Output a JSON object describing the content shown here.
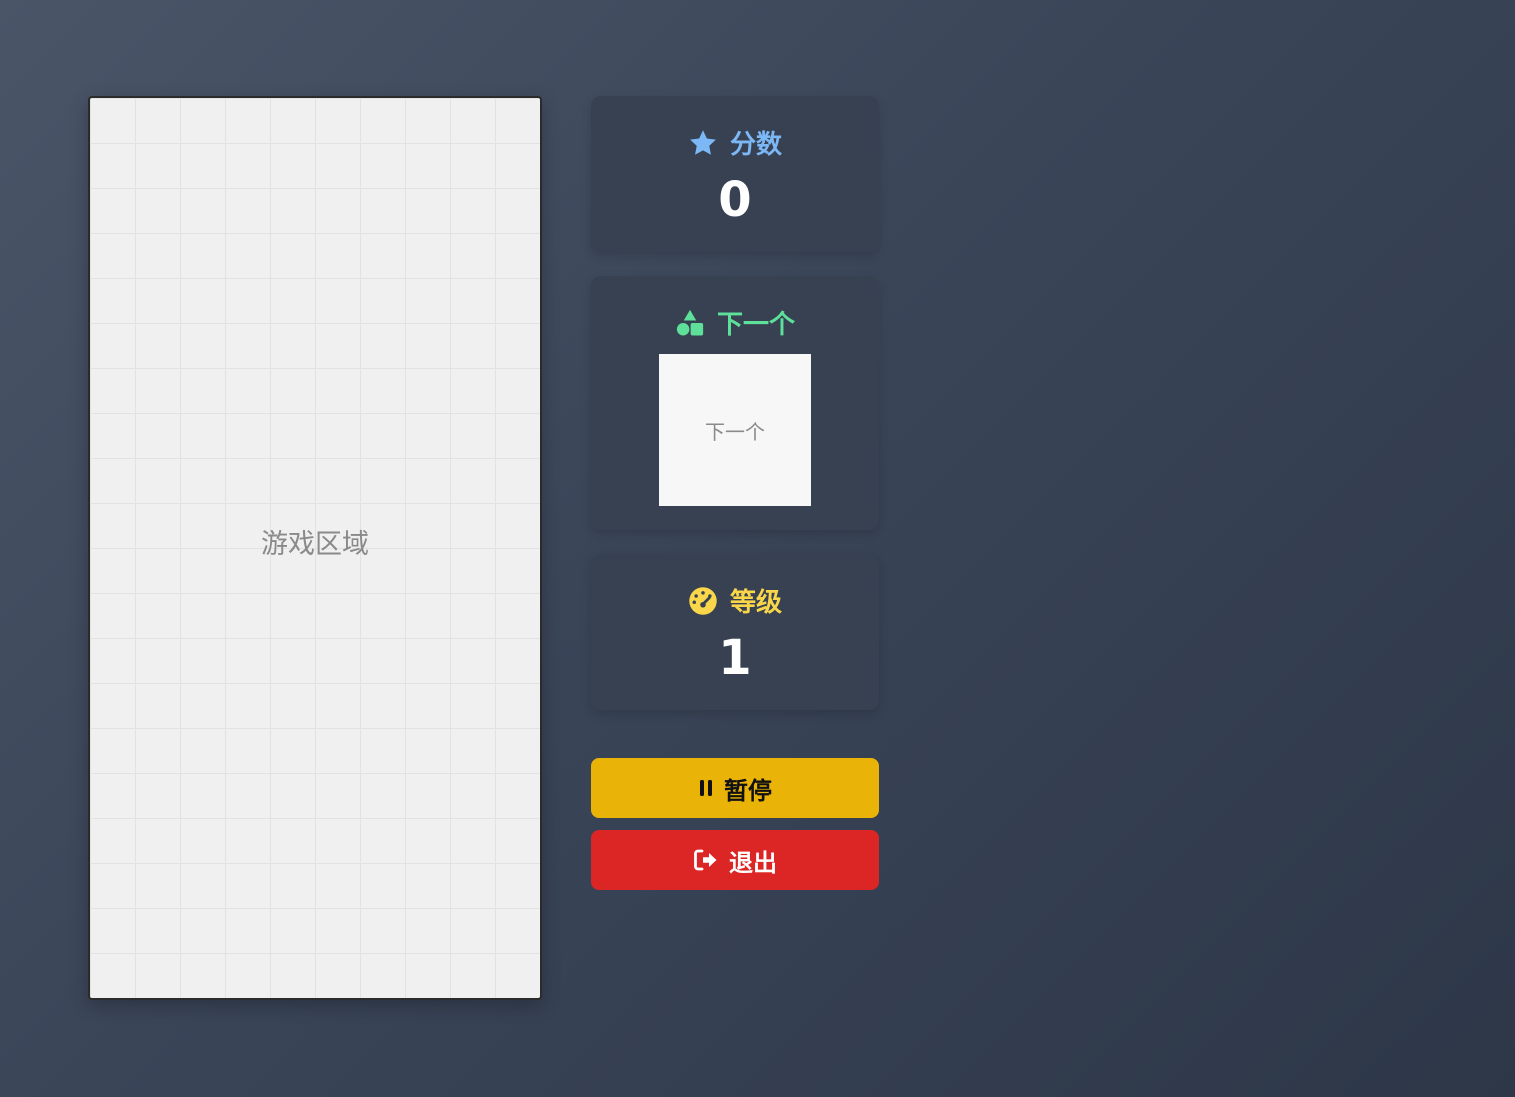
{
  "board": {
    "label": "游戏区域",
    "columns": 10,
    "rows": 20
  },
  "score": {
    "title": "分数",
    "value": "0",
    "icon": "star-icon",
    "color": "#7cb7f6"
  },
  "next": {
    "title": "下一个",
    "preview_label": "下一个",
    "icon": "shapes-icon",
    "color": "#5ee09a"
  },
  "level": {
    "title": "等级",
    "value": "1",
    "icon": "gauge-icon",
    "color": "#f9d64a"
  },
  "buttons": {
    "pause_label": "暂停",
    "pause_icon": "pause-icon",
    "pause_color": "#eab308",
    "exit_label": "退出",
    "exit_icon": "sign-out-icon",
    "exit_color": "#dc2626"
  }
}
